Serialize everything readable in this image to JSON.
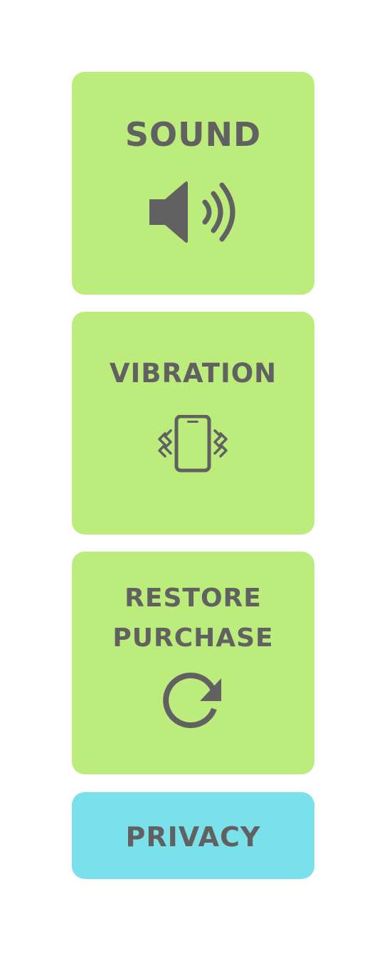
{
  "settings": {
    "sound": {
      "label": "SOUND",
      "icon": "speaker-icon"
    },
    "vibration": {
      "label": "VIBRATION",
      "icon": "vibrating-phone-icon"
    },
    "restore": {
      "label_line1": "RESTORE",
      "label_line2": "PURCHASE",
      "icon": "refresh-icon"
    },
    "privacy": {
      "label": "PRIVACY"
    }
  },
  "colors": {
    "tile_green": "#bcec7b",
    "tile_cyan": "#7ae1eb",
    "text": "#616161"
  }
}
